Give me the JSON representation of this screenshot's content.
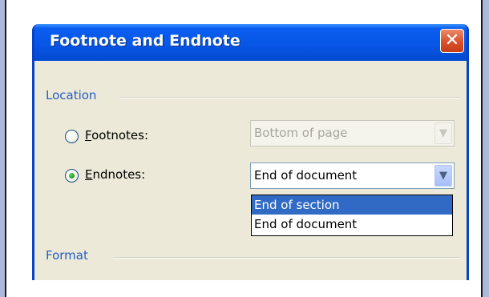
{
  "dialog": {
    "title": "Footnote and Endnote",
    "close_glyph": "✕"
  },
  "location": {
    "group_label": "Location",
    "footnotes": {
      "label_accel": "F",
      "label_rest": "ootnotes:",
      "checked": false,
      "select_value": "Bottom of page",
      "enabled": false
    },
    "endnotes": {
      "label_accel": "E",
      "label_rest": "ndnotes:",
      "checked": true,
      "select_value": "End of document",
      "enabled": true
    },
    "endnotes_dropdown": {
      "options": [
        "End of section",
        "End of document"
      ],
      "highlighted": "End of section"
    }
  },
  "format": {
    "group_label": "Format"
  },
  "icons": {
    "dropdown_arrow": "chevron-down-icon",
    "close": "close-icon"
  },
  "colors": {
    "titlebar": "#0756e6",
    "group_label": "#215dc6",
    "selection": "#316ac5",
    "dialog_bg": "#ece9d8"
  }
}
